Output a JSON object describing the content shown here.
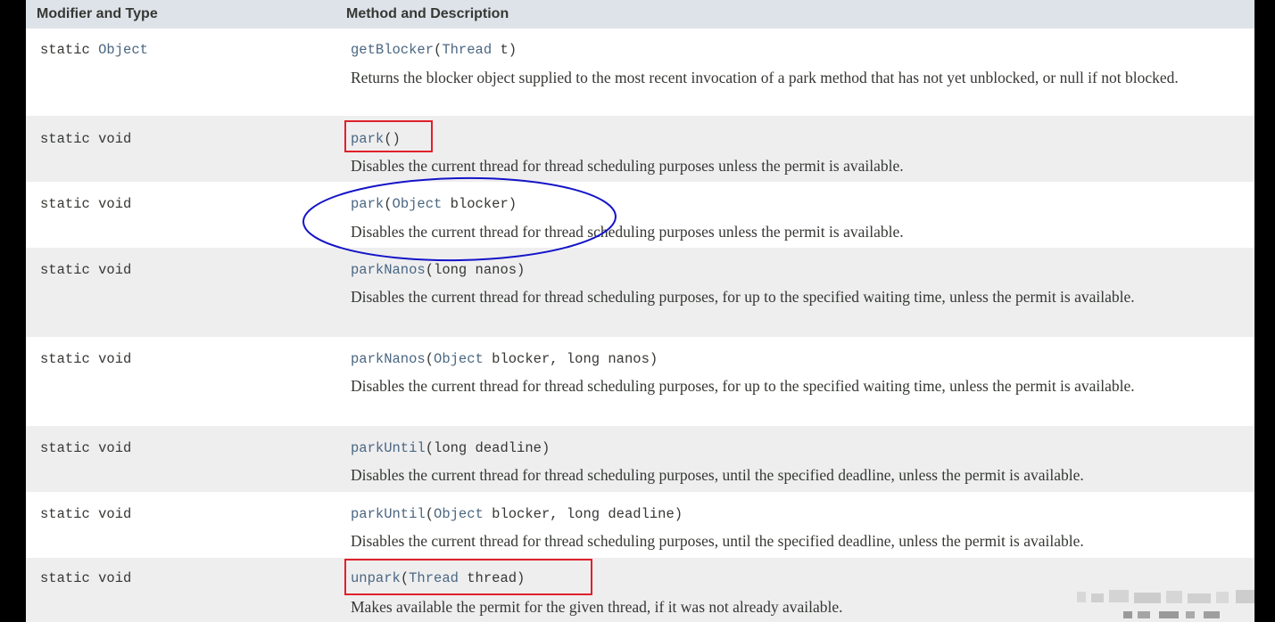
{
  "table": {
    "col_type": "Modifier and Type",
    "col_method": "Method and Description",
    "rows": [
      {
        "kw": "static",
        "type": "Object",
        "name": "getBlocker",
        "params_link": "Thread",
        "params_rest": " t)",
        "desc": "Returns the blocker object supplied to the most recent invocation of a park method that has not yet unblocked, or null if not blocked."
      },
      {
        "kw": "static",
        "type": "void",
        "name": "park",
        "params_link": "",
        "params_rest": ")",
        "desc": "Disables the current thread for thread scheduling purposes unless the permit is available."
      },
      {
        "kw": "static",
        "type": "void",
        "name": "park",
        "params_link": "Object",
        "params_rest": " blocker)",
        "desc": "Disables the current thread for thread scheduling purposes unless the permit is available."
      },
      {
        "kw": "static",
        "type": "void",
        "name": "parkNanos",
        "params_link": "",
        "params_rest": "long nanos)",
        "desc": "Disables the current thread for thread scheduling purposes, for up to the specified waiting time, unless the permit is available."
      },
      {
        "kw": "static",
        "type": "void",
        "name": "parkNanos",
        "params_link": "Object",
        "params_rest": " blocker, long nanos)",
        "desc": "Disables the current thread for thread scheduling purposes, for up to the specified waiting time, unless the permit is available."
      },
      {
        "kw": "static",
        "type": "void",
        "name": "parkUntil",
        "params_link": "",
        "params_rest": "long deadline)",
        "desc": "Disables the current thread for thread scheduling purposes, until the specified deadline, unless the permit is available."
      },
      {
        "kw": "static",
        "type": "void",
        "name": "parkUntil",
        "params_link": "Object",
        "params_rest": " blocker, long deadline)",
        "desc": "Disables the current thread for thread scheduling purposes, until the specified deadline, unless the permit is available."
      },
      {
        "kw": "static",
        "type": "void",
        "name": "unpark",
        "params_link": "Thread",
        "params_rest": " thread)",
        "desc": "Makes available the permit for the given thread, if it was not already available."
      }
    ]
  },
  "annotations": {
    "red_box_color": "#e0202a",
    "blue_ellipse_color": "#1414c8"
  },
  "colors": {
    "header_bg": "#dee3e9",
    "alt_row_bg": "#eeeeef",
    "link": "#4a6782",
    "text": "#353833"
  }
}
